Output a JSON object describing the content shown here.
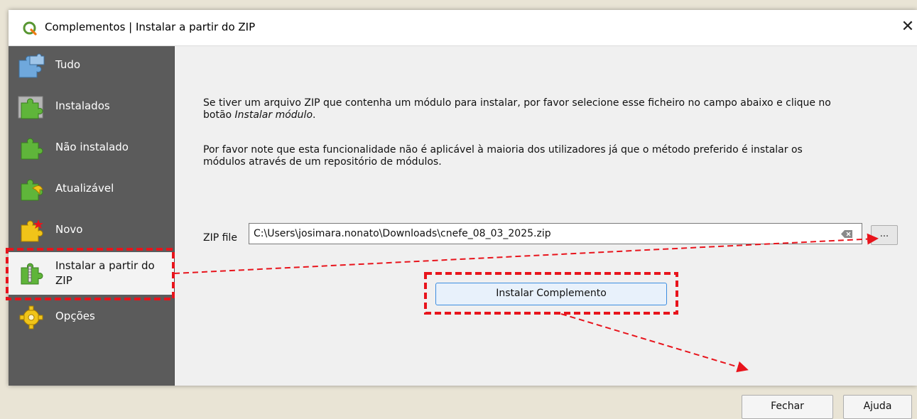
{
  "window": {
    "title": "Complementos | Instalar a partir do ZIP",
    "close_glyph": "✕"
  },
  "sidebar": {
    "items": [
      {
        "label": "Tudo",
        "icon": "puzzle-all-icon"
      },
      {
        "label": "Instalados",
        "icon": "puzzle-installed-icon"
      },
      {
        "label": "Não instalado",
        "icon": "puzzle-not-installed-icon"
      },
      {
        "label": "Atualizável",
        "icon": "puzzle-upgradeable-icon"
      },
      {
        "label": "Novo",
        "icon": "puzzle-new-icon"
      },
      {
        "label": "Instalar a partir do ZIP",
        "label_line1": "Instalar a partir do",
        "label_line2": "ZIP",
        "icon": "puzzle-zip-icon",
        "selected": true
      },
      {
        "label": "Opções",
        "icon": "gear-options-icon"
      }
    ]
  },
  "main": {
    "para1_line1": "Se tiver um arquivo ZIP que contenha um módulo para instalar, por favor selecione esse ficheiro no campo abaixo e clique no",
    "para1_line2_prefix": "botão ",
    "para1_line2_em": "Instalar módulo",
    "para1_line2_suffix": ".",
    "para2_line1": "Por favor note que esta funcionalidade não é aplicável à maioria dos utilizadores já que o método preferido é instalar os",
    "para2_line2": "módulos através de um repositório de módulos.",
    "zip_label": "ZIP file",
    "zip_value": "C:\\Users\\josimara.nonato\\Downloads\\cnefe_08_03_2025.zip",
    "browse_label": "...",
    "install_label": "Instalar Complemento"
  },
  "footer": {
    "close_label": "Fechar",
    "help_label": "Ajuda"
  },
  "annotation_color": "#e8141c"
}
